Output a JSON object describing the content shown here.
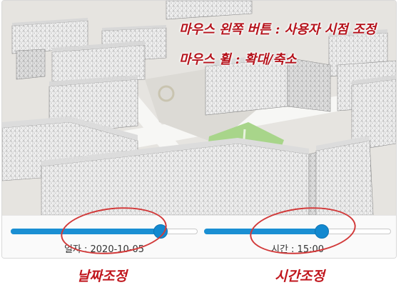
{
  "map": {
    "annotations": {
      "left_button": "마우스 왼쪽 버튼 : 사용자 시점 조정",
      "wheel": "마우스 휠 : 확대/축소"
    }
  },
  "controls": {
    "date": {
      "label": "일자 : 2020-10-05",
      "progress": 0.8
    },
    "time": {
      "label": "시간 : 15:00",
      "progress": 0.63
    }
  },
  "callouts": {
    "date": "날짜조정",
    "time": "시간조정"
  },
  "colors": {
    "accent": "#1a8fd3",
    "annotation": "#b5121b",
    "building": "#f3f3f3",
    "park": "#a8d58a"
  }
}
